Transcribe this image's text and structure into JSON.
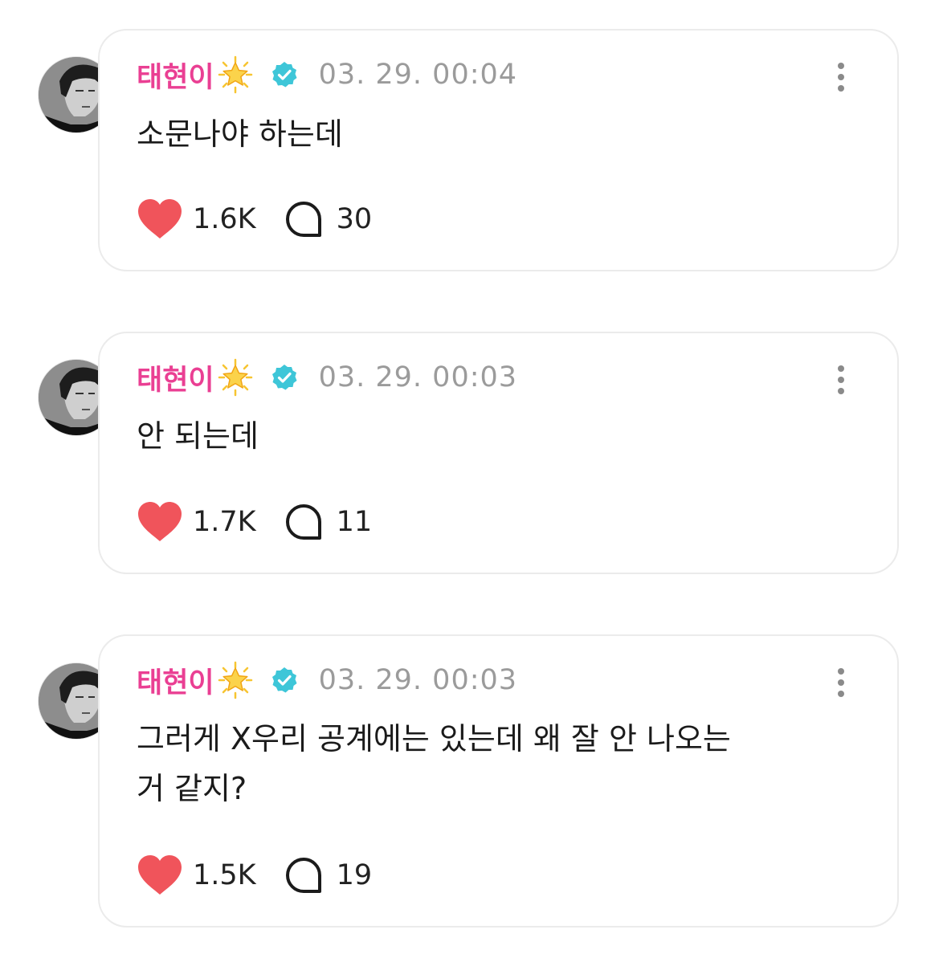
{
  "posts": [
    {
      "username": "태현이",
      "timestamp": "03. 29. 00:04",
      "text": "소문나야 하는데",
      "likes": "1.6K",
      "comments": "30"
    },
    {
      "username": "태현이",
      "timestamp": "03. 29. 00:03",
      "text": "안 되는데",
      "likes": "1.7K",
      "comments": "11"
    },
    {
      "username": "태현이",
      "timestamp": "03. 29. 00:03",
      "text_line1": "그러게 X우리 공계에는 있는데 왜 잘 안 나오는",
      "text_line2": "거 같지?",
      "likes": "1.5K",
      "comments": "19"
    }
  ],
  "icons": {
    "username_badge": "glowing-star-icon",
    "verified": "verified-badge-icon",
    "more": "more-vertical-icon",
    "like": "heart-icon",
    "comment": "comment-bubble-icon"
  },
  "colors": {
    "username": "#ea3f93",
    "timestamp": "#9b9b9b",
    "heart": "#f0545b",
    "verified": "#3ec6d8",
    "bubble_border": "#ebebeb"
  }
}
